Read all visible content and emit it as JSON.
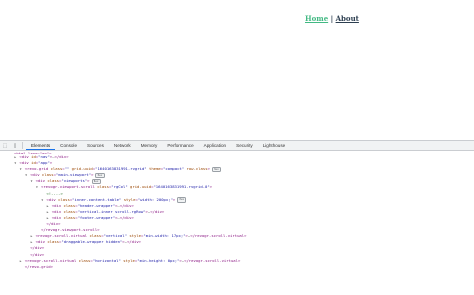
{
  "app": {
    "nav": {
      "home_label": "Home",
      "separator": "|",
      "about_label": "About",
      "home_color": "#42b983",
      "about_color": "#2c3e50"
    }
  },
  "devtools": {
    "toolbar": {
      "inspect_glyph": "⬚",
      "device_glyph": "▯",
      "tabs": [
        "Elements",
        "Console",
        "Sources",
        "Network",
        "Memory",
        "Performance",
        "Application",
        "Security",
        "Lighthouse"
      ],
      "active_tab": "Elements",
      "accent_color": "#1a73e8"
    },
    "dom_lines": [
      {
        "indent": 0,
        "arrow": "",
        "parts": [
          [
            "tag",
            "<html lang=\"en\""
          ],
          [
            "tag",
            ">"
          ]
        ],
        "cut": true
      },
      {
        "indent": 1,
        "arrow": "▶",
        "parts": [
          [
            "tag",
            "<div "
          ],
          [
            "attr",
            "id"
          ],
          [
            "tag",
            "="
          ],
          [
            "val",
            "\"nav\""
          ],
          [
            "tag",
            ">"
          ],
          [
            "ell",
            "…"
          ],
          [
            "tag",
            "</div>"
          ]
        ]
      },
      {
        "indent": 1,
        "arrow": "▼",
        "parts": [
          [
            "tag",
            "<div "
          ],
          [
            "attr",
            "id"
          ],
          [
            "tag",
            "="
          ],
          [
            "val",
            "\"app\""
          ],
          [
            "tag",
            ">"
          ]
        ]
      },
      {
        "indent": 2,
        "arrow": "▼",
        "parts": [
          [
            "tag",
            "<revo-grid "
          ],
          [
            "attr",
            "class"
          ],
          [
            "tag",
            "="
          ],
          [
            "val",
            "\"\""
          ],
          [
            "tag",
            " "
          ],
          [
            "attr",
            "grid-uuid"
          ],
          [
            "tag",
            "="
          ],
          [
            "val",
            "\"1640163831991-rvgrid\""
          ],
          [
            "tag",
            " "
          ],
          [
            "attr",
            "theme"
          ],
          [
            "tag",
            "="
          ],
          [
            "val",
            "\"compact\""
          ],
          [
            "tag",
            " "
          ],
          [
            "attr",
            "row-class"
          ],
          [
            "tag",
            ">"
          ]
        ],
        "badge": "flex"
      },
      {
        "indent": 3,
        "arrow": "▼",
        "parts": [
          [
            "tag",
            "<div "
          ],
          [
            "attr",
            "class"
          ],
          [
            "tag",
            "="
          ],
          [
            "val",
            "\"main-viewport\""
          ],
          [
            "tag",
            ">"
          ]
        ],
        "badge": "flex"
      },
      {
        "indent": 4,
        "arrow": "▼",
        "parts": [
          [
            "tag",
            "<div "
          ],
          [
            "attr",
            "class"
          ],
          [
            "tag",
            "="
          ],
          [
            "val",
            "\"viewports\""
          ],
          [
            "tag",
            ">"
          ]
        ],
        "badge": "flex"
      },
      {
        "indent": 5,
        "arrow": "▼",
        "parts": [
          [
            "tag",
            "<revogr-viewport-scroll "
          ],
          [
            "attr",
            "class"
          ],
          [
            "tag",
            "="
          ],
          [
            "val",
            "\"rgCol\""
          ],
          [
            "tag",
            " "
          ],
          [
            "attr",
            "grid-uuid"
          ],
          [
            "tag",
            "="
          ],
          [
            "val",
            "\"1640163831991-rvgrid-0\""
          ],
          [
            "tag",
            ">"
          ]
        ]
      },
      {
        "indent": 6,
        "arrow": "",
        "parts": [
          [
            "cmt",
            "<!---->"
          ]
        ]
      },
      {
        "indent": 6,
        "arrow": "▼",
        "parts": [
          [
            "tag",
            "<div "
          ],
          [
            "attr",
            "class"
          ],
          [
            "tag",
            "="
          ],
          [
            "val",
            "\"inner-content-table\""
          ],
          [
            "tag",
            " "
          ],
          [
            "attr",
            "style"
          ],
          [
            "tag",
            "="
          ],
          [
            "val",
            "\"width: 200px;\""
          ],
          [
            "tag",
            ">"
          ]
        ],
        "badge": "flex"
      },
      {
        "indent": 7,
        "arrow": "▶",
        "parts": [
          [
            "tag",
            "<div "
          ],
          [
            "attr",
            "class"
          ],
          [
            "tag",
            "="
          ],
          [
            "val",
            "\"header-wrapper\""
          ],
          [
            "tag",
            ">"
          ],
          [
            "ell",
            "…"
          ],
          [
            "tag",
            "</div>"
          ]
        ]
      },
      {
        "indent": 7,
        "arrow": "▶",
        "parts": [
          [
            "tag",
            "<div "
          ],
          [
            "attr",
            "class"
          ],
          [
            "tag",
            "="
          ],
          [
            "val",
            "\"vertical-inner scroll-rgRow\""
          ],
          [
            "tag",
            ">"
          ],
          [
            "ell",
            "…"
          ],
          [
            "tag",
            "</div>"
          ]
        ]
      },
      {
        "indent": 7,
        "arrow": "▶",
        "parts": [
          [
            "tag",
            "<div "
          ],
          [
            "attr",
            "class"
          ],
          [
            "tag",
            "="
          ],
          [
            "val",
            "\"footer-wrapper\""
          ],
          [
            "tag",
            ">"
          ],
          [
            "ell",
            "…"
          ],
          [
            "tag",
            "</div>"
          ]
        ]
      },
      {
        "indent": 6,
        "arrow": "",
        "parts": [
          [
            "tag",
            "</div>"
          ]
        ]
      },
      {
        "indent": 5,
        "arrow": "",
        "parts": [
          [
            "tag",
            "</revogr-viewport-scroll>"
          ]
        ]
      },
      {
        "indent": 4,
        "arrow": "▶",
        "parts": [
          [
            "tag",
            "<revogr-scroll-virtual "
          ],
          [
            "attr",
            "class"
          ],
          [
            "tag",
            "="
          ],
          [
            "val",
            "\"vertical\""
          ],
          [
            "tag",
            " "
          ],
          [
            "attr",
            "style"
          ],
          [
            "tag",
            "="
          ],
          [
            "val",
            "\"min-width: 17px;\""
          ],
          [
            "tag",
            ">"
          ],
          [
            "ell",
            "…"
          ],
          [
            "tag",
            "</revogr-scroll-virtual>"
          ]
        ]
      },
      {
        "indent": 4,
        "arrow": "▶",
        "parts": [
          [
            "tag",
            "<div "
          ],
          [
            "attr",
            "class"
          ],
          [
            "tag",
            "="
          ],
          [
            "val",
            "\"draggable-wrapper hidden\""
          ],
          [
            "tag",
            ">"
          ],
          [
            "ell",
            "…"
          ],
          [
            "tag",
            "</div>"
          ]
        ]
      },
      {
        "indent": 3,
        "arrow": "",
        "parts": [
          [
            "tag",
            "</div>"
          ]
        ]
      },
      {
        "indent": 3,
        "arrow": "",
        "parts": [
          [
            "tag",
            "</div>"
          ]
        ]
      },
      {
        "indent": 2,
        "arrow": "▶",
        "parts": [
          [
            "tag",
            "<revogr-scroll-virtual "
          ],
          [
            "attr",
            "class"
          ],
          [
            "tag",
            "="
          ],
          [
            "val",
            "\"horizontal\""
          ],
          [
            "tag",
            " "
          ],
          [
            "attr",
            "style"
          ],
          [
            "tag",
            "="
          ],
          [
            "val",
            "\"min-height: 0px;\""
          ],
          [
            "tag",
            ">"
          ],
          [
            "ell",
            "…"
          ],
          [
            "tag",
            "</revogr-scroll-virtual>"
          ]
        ]
      },
      {
        "indent": 2,
        "arrow": "",
        "parts": [
          [
            "tag",
            "</revo-grid>"
          ]
        ]
      }
    ]
  }
}
